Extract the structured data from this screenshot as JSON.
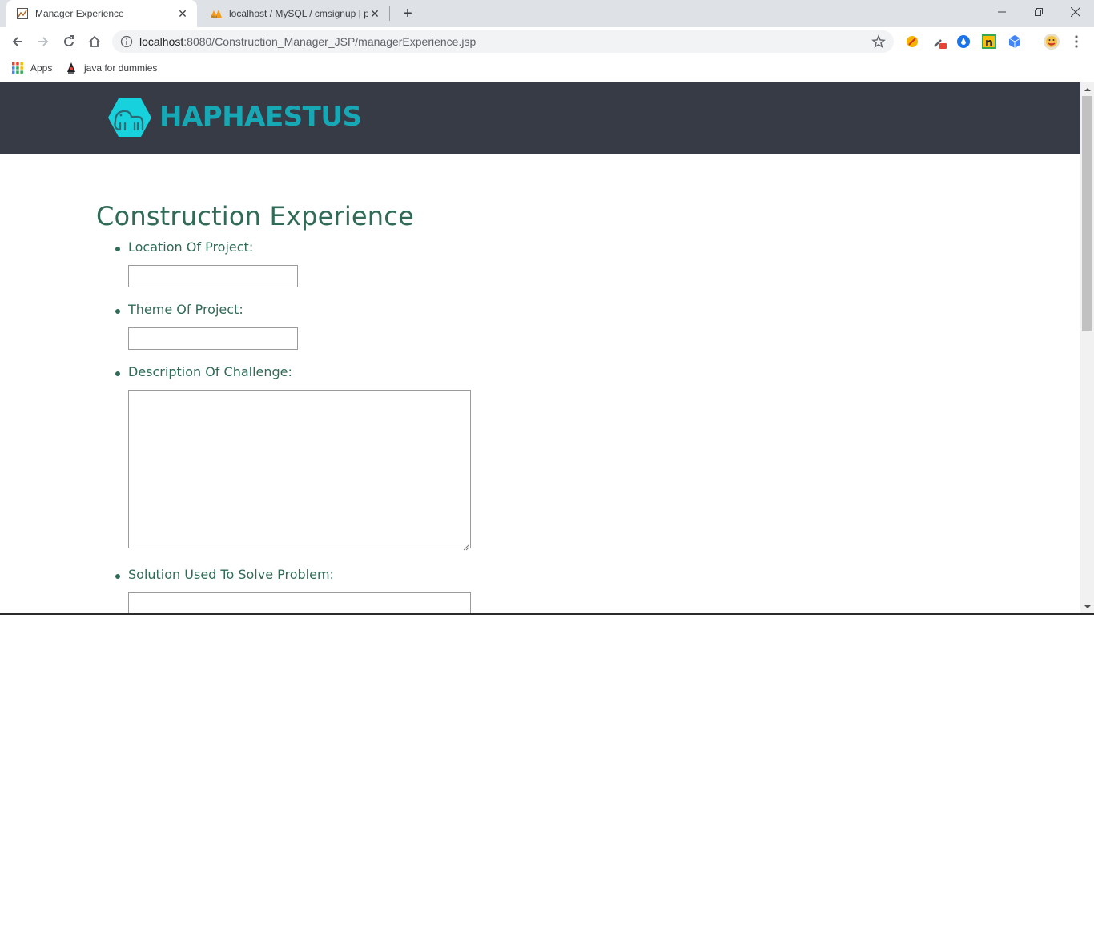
{
  "browser": {
    "tabs": [
      {
        "title": "Manager Experience",
        "active": true,
        "favicon": "page-favicon"
      },
      {
        "title": "localhost / MySQL / cmsignup | p",
        "active": false,
        "favicon": "phpmyadmin-favicon"
      }
    ],
    "url_host": "localhost",
    "url_rest": ":8080/Construction_Manager_JSP/managerExperience.jsp",
    "bookmarks": [
      {
        "label": "Apps",
        "icon": "apps-grid-icon"
      },
      {
        "label": "java for dummies",
        "icon": "duke-icon"
      }
    ]
  },
  "site": {
    "brand": "HAPHAESTUS",
    "header_color": "#373b45",
    "accent_color": "#17a8b6"
  },
  "form": {
    "title": "Construction Experience",
    "fields": [
      {
        "label": "Location Of Project:",
        "type": "text",
        "value": ""
      },
      {
        "label": "Theme Of Project:",
        "type": "text",
        "value": ""
      },
      {
        "label": "Description Of Challenge:",
        "type": "textarea",
        "value": ""
      },
      {
        "label": "Solution Used To Solve Problem:",
        "type": "textarea",
        "value": ""
      }
    ],
    "text_color": "#2f6b57"
  }
}
